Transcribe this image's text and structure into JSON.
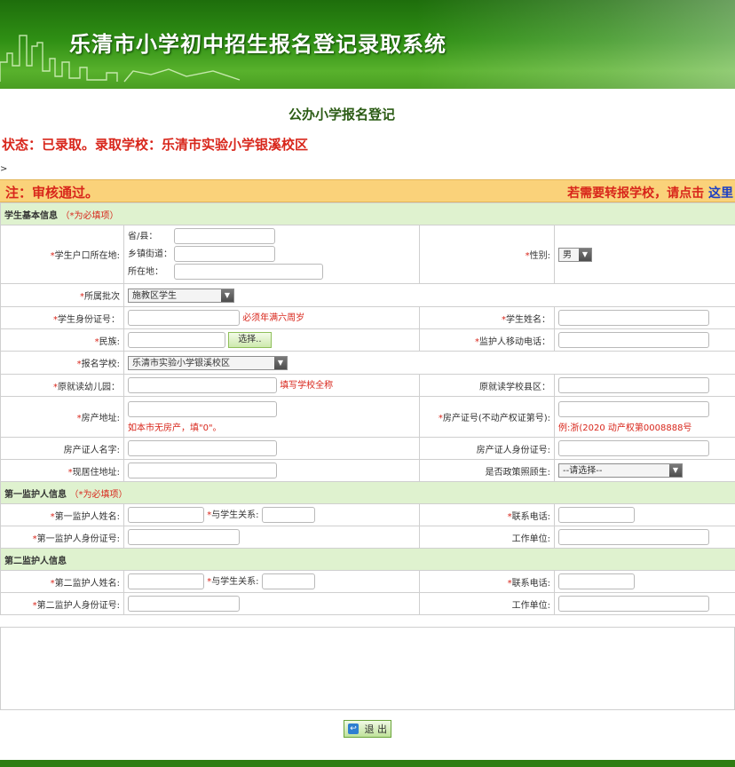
{
  "header": {
    "title": "乐清市小学初中招生报名登记录取系统"
  },
  "page_title": "公办小学报名登记",
  "status": "状态：已录取。录取学校：乐清市实验小学银溪校区",
  "gt": ">",
  "notice": {
    "left": "注：审核通过。",
    "right": "若需要转报学校，请点击",
    "link": "这里"
  },
  "sections": {
    "student": {
      "title": "学生基本信息",
      "req": "（*为必填项）"
    },
    "guardian1": {
      "title": "第一监护人信息",
      "req": "（*为必填项）"
    },
    "guardian2": {
      "title": "第二监护人信息"
    }
  },
  "labels": {
    "hukou": "学生户口所在地:",
    "province": "省/县：",
    "town": "乡镇街道：",
    "place": "所在地：",
    "gender": "性别:",
    "batch": "所属批次",
    "idcard": "学生身份证号：",
    "name": "学生姓名：",
    "nation": "民族:",
    "guardian_phone": "监护人移动电话：",
    "school": "报名学校:",
    "kindergarten": "原就读幼儿园：",
    "orig_school_county": "原就读学校县区：",
    "house_addr": "房产地址:",
    "house_cert": "房产证号(不动产权证第号):",
    "owner_name": "房产证人名字:",
    "owner_id": "房产证人身份证号:",
    "current_addr": "现居住地址:",
    "policy": "是否政策照顾生:",
    "g1_name": "第一监护人姓名:",
    "g1_relation": "与学生关系:",
    "g1_phone": "联系电话:",
    "g1_id": "第一监护人身份证号:",
    "g1_work": "工作单位:",
    "g2_name": "第二监护人姓名:",
    "g2_relation": "与学生关系:",
    "g2_phone": "联系电话:",
    "g2_id": "第二监护人身份证号:",
    "g2_work": "工作单位:"
  },
  "values": {
    "gender": "男",
    "batch": "施教区学生",
    "school": "乐清市实验小学银溪校区",
    "policy": "--请选择--"
  },
  "buttons": {
    "choose": "选择..",
    "exit": "退 出"
  },
  "hints": {
    "idcard": "必须年满六周岁",
    "kindergarten": "填写学校全称",
    "house_addr": "如本市无房产，填\"0\"。",
    "house_cert": "例:浙(2020          动产权第0008888号"
  },
  "colors": {
    "accent_red": "#d8261b",
    "section_green": "#dff2cf",
    "banner_green": "#2f8f14",
    "notice_bg": "#fad27a"
  }
}
